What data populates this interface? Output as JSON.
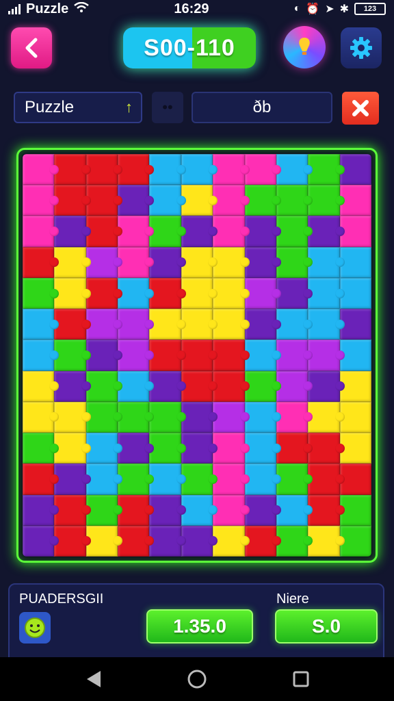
{
  "status_bar": {
    "carrier": "Puzzle",
    "time": "16:29",
    "battery": "123"
  },
  "header": {
    "score": "S00-110"
  },
  "toolbar": {
    "puzzle_label": "Puzzle",
    "dots": "••",
    "value": "ðb"
  },
  "colors": {
    "accent_green": "#3cff22",
    "accent_pink": "#ff3ea0",
    "accent_cyan": "#1cc5f0",
    "close_red": "#e22d1f"
  },
  "board": {
    "palette": {
      "P": "#ff2fb4",
      "R": "#e4161f",
      "G": "#2fd618",
      "B": "#21b6f2",
      "Y": "#ffe61a",
      "V": "#6a22b8",
      "M": "#b52fe6"
    },
    "rows": [
      "PRRRBBPPBGV",
      "PRRVBYPGGGP",
      "PVRPGVPVGVP",
      "RYMPVYYVGBB",
      "GYRBRYYMVBB",
      "BRMMYYYVBBV",
      "BGVMRRRBMMB",
      "YVGBVRRGMVY",
      "YYGGGVMBPYY",
      "GYBVGVPBRRY",
      "RVBGBGPBGRR",
      "VRGRVBPVBRG",
      "VRYRVVYRGYG"
    ]
  },
  "bottom_panel": {
    "left_label": "PUADERSGII",
    "right_label": "Niere",
    "left_button": "1.35.0",
    "right_button": "S.0"
  }
}
